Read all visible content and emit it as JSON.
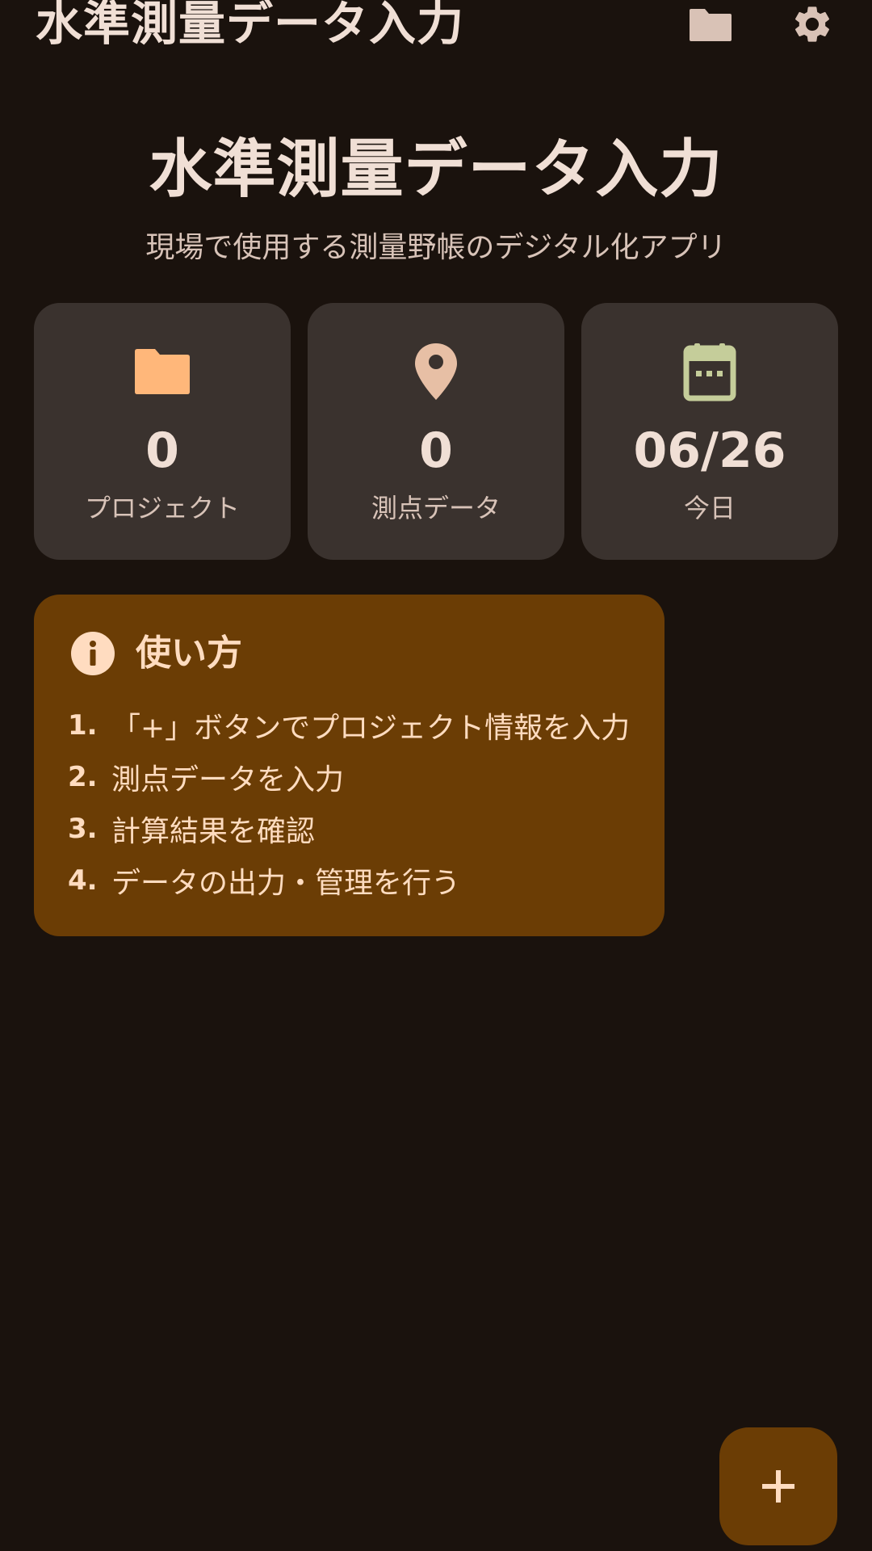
{
  "app_bar": {
    "title": "水準測量データ入力",
    "actions": [
      {
        "icon": "folder-icon"
      },
      {
        "icon": "gear-icon"
      }
    ]
  },
  "header": {
    "title": "水準測量データ入力",
    "subtitle": "現場で使用する測量野帳のデジタル化アプリ"
  },
  "stats": [
    {
      "icon": "folder-icon",
      "value": "0",
      "label": "プロジェクト",
      "icon_color": "#ffb77a"
    },
    {
      "icon": "location-pin-icon",
      "value": "0",
      "label": "測点データ",
      "icon_color": "#e7bfa5"
    },
    {
      "icon": "calendar-icon",
      "value": "06/26",
      "label": "今日",
      "icon_color": "#c5cd9a"
    }
  ],
  "info_card": {
    "icon": "info-icon",
    "title": "使い方",
    "steps": [
      {
        "num": "1.",
        "text": "「+」ボタンでプロジェクト情報を入力"
      },
      {
        "num": "2.",
        "text": "測点データを入力"
      },
      {
        "num": "3.",
        "text": "計算結果を確認"
      },
      {
        "num": "4.",
        "text": "データの出力・管理を行う"
      }
    ]
  },
  "fab": {
    "icon": "plus-icon"
  },
  "colors": {
    "background": "#1a120d",
    "card": "#3a322e",
    "accent_container": "#6b3d05",
    "on_accent": "#ffdcc0",
    "text_primary": "#f0dfd5"
  }
}
